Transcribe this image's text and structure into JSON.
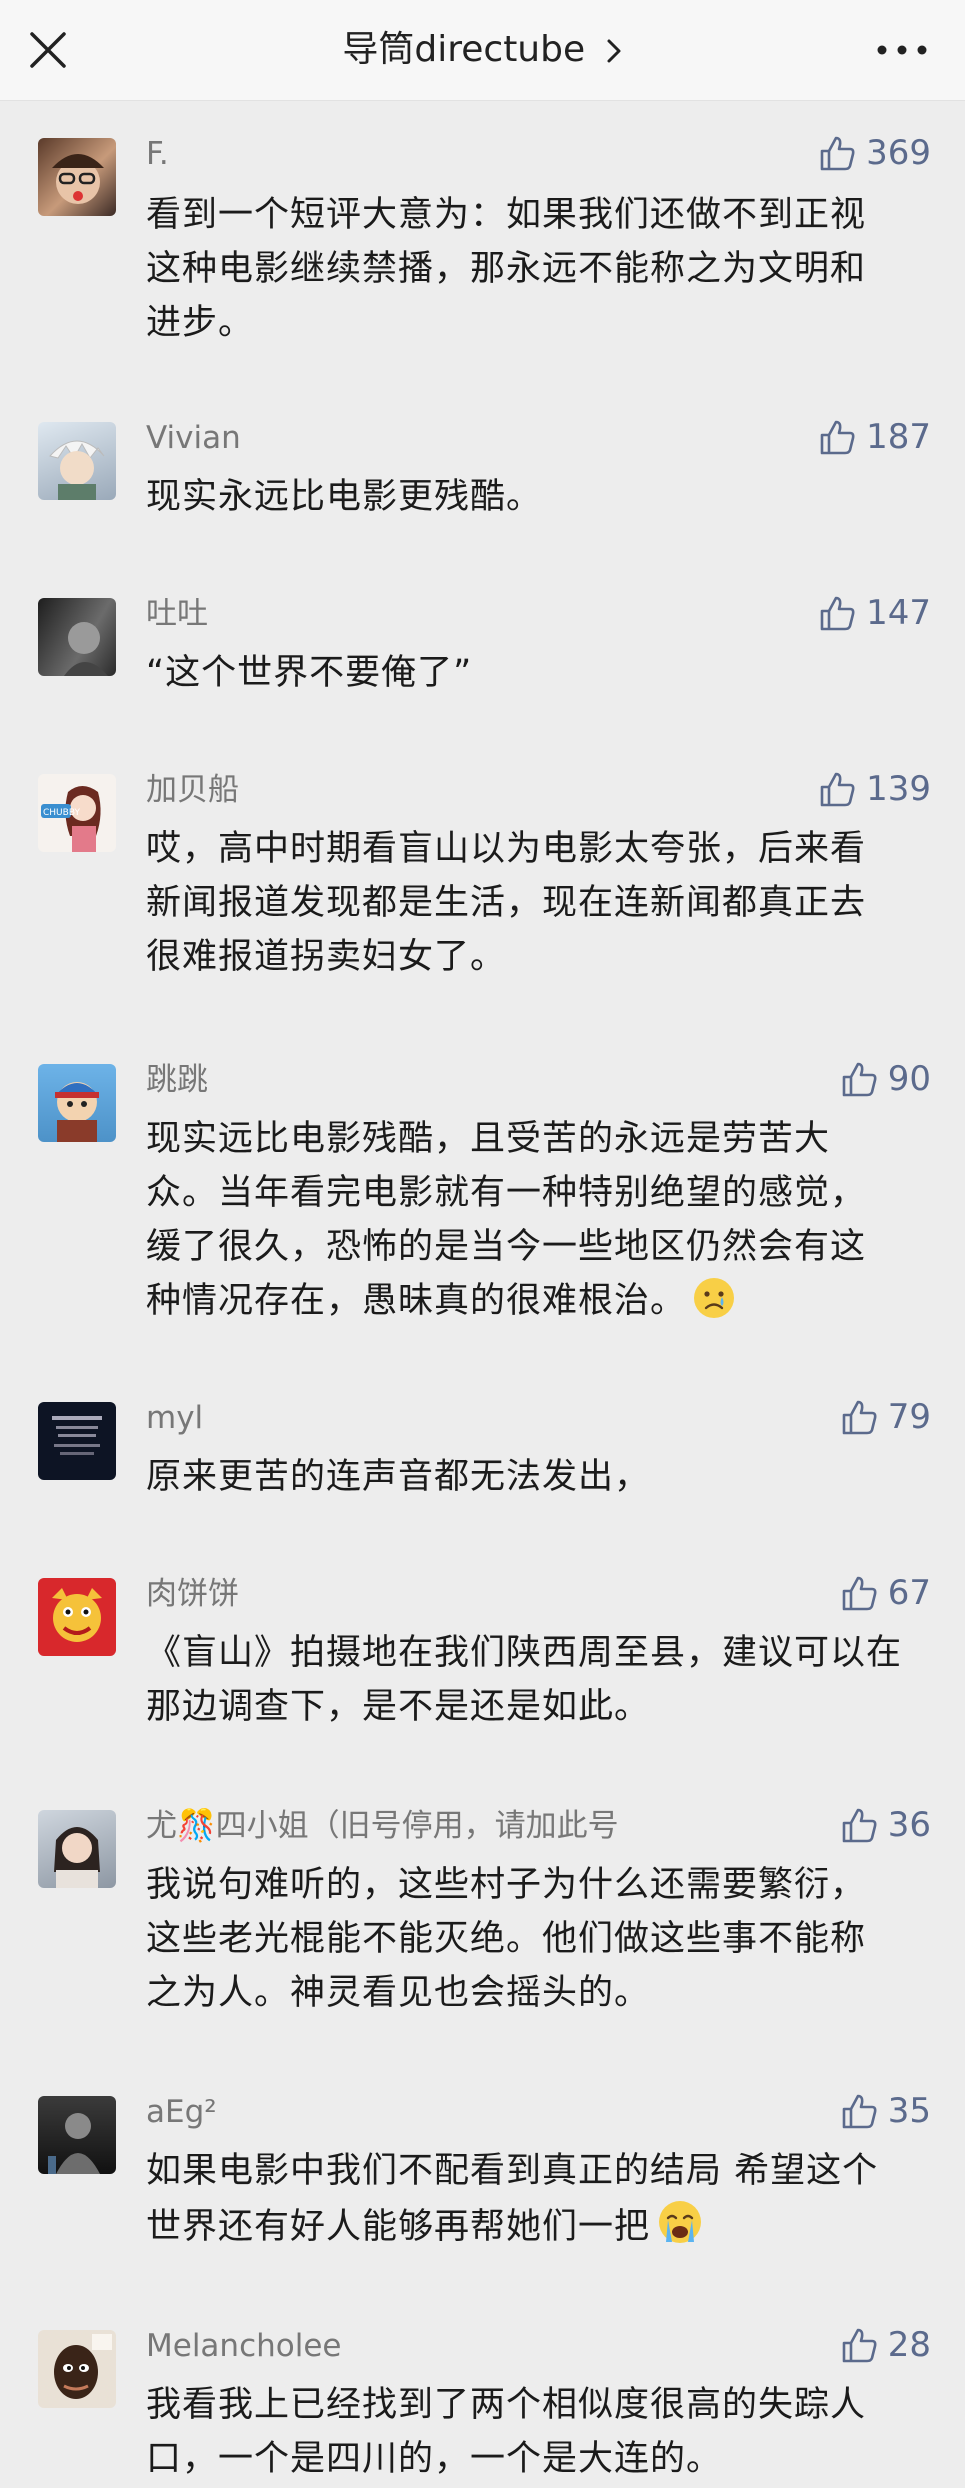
{
  "header": {
    "title": "导筒directube",
    "close_icon": "close-icon",
    "more_icon": "more-icon",
    "chevron_icon": "chevron-right-icon"
  },
  "colors": {
    "background": "#ededed",
    "topbar": "#f7f7f7",
    "like_accent": "#5b6a8c",
    "name_gray": "#777777"
  },
  "comments": [
    {
      "name": "F.",
      "likes": "369",
      "lines": [
        "看到一个短评大意为：如果我们还做不到正视",
        "这种电影继续禁播，那永远不能称之为文明和",
        "进步。"
      ]
    },
    {
      "name": "Vivian",
      "likes": "187",
      "lines": [
        "现实永远比电影更残酷。"
      ]
    },
    {
      "name": "吐吐",
      "likes": "147",
      "lines": [
        "“这个世界不要俺了”"
      ]
    },
    {
      "name": "加贝船",
      "likes": "139",
      "lines": [
        "哎，高中时期看盲山以为电影太夸张，后来看",
        "新闻报道发现都是生活，现在连新闻都真正去",
        "很难报道拐卖妇女了。"
      ]
    },
    {
      "name": "跳跳",
      "likes": "90",
      "lines": [
        "现实远比电影残酷，且受苦的永远是劳苦大",
        "众。当年看完电影就有一种特别绝望的感觉，",
        "缓了很久，恐怖的是当今一些地区仍然会有这",
        "种情况存在，愚昧真的很难根治。"
      ]
    },
    {
      "name": "myl",
      "likes": "79",
      "lines": [
        "原来更苦的连声音都无法发出，"
      ]
    },
    {
      "name": "肉饼饼",
      "likes": "67",
      "lines": [
        "《盲山》拍摄地在我们陕西周至县，建议可以在",
        "那边调查下，是不是还是如此。"
      ]
    },
    {
      "name": "尤🎊四小姐（旧号停用，请加此号",
      "likes": "36",
      "lines": [
        "我说句难听的，这些村子为什么还需要繁衍，",
        "这些老光棍能不能灭绝。他们做这些事不能称",
        "之为人。神灵看见也会摇头的。"
      ]
    },
    {
      "name": "aEg²",
      "likes": "35",
      "lines": [
        "如果电影中我们不配看到真正的结局 希望这个",
        "世界还有好人能够再帮她们一把"
      ]
    },
    {
      "name": "Melancholee",
      "likes": "28",
      "lines": [
        "我看我上已经找到了两个相似度很高的失踪人",
        "口，一个是四川的，一个是大连的。"
      ]
    }
  ]
}
